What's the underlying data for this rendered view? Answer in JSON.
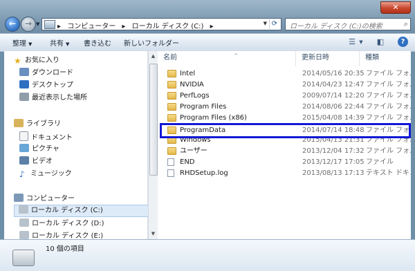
{
  "window": {
    "close_glyph": "✕"
  },
  "address_bar": {
    "crumbs": [
      "▸",
      "コンピューター",
      "▸",
      "ローカル ディスク (C:)",
      "▸"
    ]
  },
  "search": {
    "placeholder": "ローカル ディスク (C:)の検索"
  },
  "toolbar": {
    "organize": "整理",
    "share": "共有",
    "burn": "書き込む",
    "new_folder": "新しいフォルダー"
  },
  "nav_pane": {
    "favorites": {
      "label": "お気に入り",
      "items": [
        "ダウンロード",
        "デスクトップ",
        "最近表示した場所"
      ]
    },
    "libraries": {
      "label": "ライブラリ",
      "items": [
        "ドキュメント",
        "ピクチャ",
        "ビデオ",
        "ミュージック"
      ]
    },
    "computer": {
      "label": "コンピューター",
      "items": [
        "ローカル ディスク (C:)",
        "ローカル ディスク (D:)",
        "ローカル ディスク (E:)"
      ]
    }
  },
  "columns": {
    "name": "名前",
    "date": "更新日時",
    "type": "種類"
  },
  "files": [
    {
      "name": "Intel",
      "date": "2014/05/16 20:35",
      "type": "ファイル フォル"
    },
    {
      "name": "NVIDIA",
      "date": "2014/04/23 12:47",
      "type": "ファイル フォル"
    },
    {
      "name": "PerfLogs",
      "date": "2009/07/14 12:20",
      "type": "ファイル フォル"
    },
    {
      "name": "Program Files",
      "date": "2014/08/06 22:44",
      "type": "ファイル フォル"
    },
    {
      "name": "Program Files (x86)",
      "date": "2015/04/08 14:39",
      "type": "ファイル フォル"
    },
    {
      "name": "ProgramData",
      "date": "2014/07/14 18:48",
      "type": "ファイル フォル"
    },
    {
      "name": "Windows",
      "date": "2015/04/13 21:31",
      "type": "ファイル フォル"
    },
    {
      "name": "ユーザー",
      "date": "2013/12/04 17:32",
      "type": "ファイル フォル"
    },
    {
      "name": "END",
      "date": "2013/12/17 17:05",
      "type": "ファイル"
    },
    {
      "name": "RHDSetup.log",
      "date": "2013/08/13 17:13",
      "type": "テキスト ドキュ"
    }
  ],
  "status": {
    "item_count": "10 個の項目"
  },
  "icons": {
    "folder": "folder-icon",
    "file": "file-icon",
    "highlight_color": "#1218d6"
  }
}
